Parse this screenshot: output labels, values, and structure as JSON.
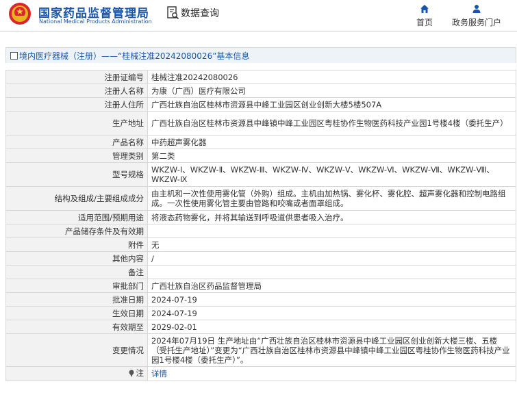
{
  "header": {
    "brand_cn": "国家药品监督管理局",
    "brand_en": "National Medical Products Administration",
    "search_label": "数据查询",
    "nav": {
      "home": "首页",
      "portal": "政务服务门户"
    },
    "accent": "#1a56a8"
  },
  "breadcrumb": "境内医疗器械（注册）——“桂械注准20242080026”基本信息",
  "rows": [
    {
      "label": "注册证编号",
      "value": "桂械注准20242080026"
    },
    {
      "label": "注册人名称",
      "value": "为康（广西）医疗有限公司"
    },
    {
      "label": "注册人住所",
      "value": "广西壮族自治区桂林市资源县中峰工业园区创业创新大楼5楼507A"
    },
    {
      "label": "生产地址",
      "value": "广西壮族自治区桂林市资源县中峰镇中峰工业园区粤桂协作生物医药科技产业园1号楼4楼（委托生产）"
    },
    {
      "label": "产品名称",
      "value": "中药超声雾化器"
    },
    {
      "label": "管理类别",
      "value": "第二类"
    },
    {
      "label": "型号规格",
      "value": "WKZW-Ⅰ、WKZW-Ⅱ、WKZW-Ⅲ、WKZW-Ⅳ、WKZW-Ⅴ、WKZW-Ⅵ、WKZW-Ⅶ、WKZW-Ⅷ、WKZW-Ⅸ"
    },
    {
      "label": "结构及组成/主要组成成分",
      "value": "由主机和一次性使用雾化管（外购）组成。主机由加热锅、雾化杯、雾化腔、超声雾化器和控制电路组成。一次性使用雾化管主要由管路和咬嘴或者面罩组成。"
    },
    {
      "label": "适用范围/预期用途",
      "value": "将液态药物雾化，并将其输送到呼吸道供患者吸入治疗。"
    },
    {
      "label": "产品储存条件及有效期",
      "value": ""
    },
    {
      "label": "附件",
      "value": "无"
    },
    {
      "label": "其他内容",
      "value": "/"
    },
    {
      "label": "备注",
      "value": ""
    },
    {
      "label": "审批部门",
      "value": "广西壮族自治区药品监督管理局"
    },
    {
      "label": "批准日期",
      "value": "2024-07-19"
    },
    {
      "label": "生效日期",
      "value": "2024-07-19"
    },
    {
      "label": "有效期至",
      "value": "2029-02-01"
    },
    {
      "label": "变更情况",
      "value": "2024年07月19日 生产地址由“广西壮族自治区桂林市资源县中峰工业园区创业创新大楼三楼、五楼（受托生产地址）”变更为“广西壮族自治区桂林市资源县中峰镇中峰工业园区粤桂协作生物医药科技产业园1号楼4楼（委托生产）”。"
    }
  ],
  "note": {
    "label": "注",
    "value": "详情",
    "icon": "pin-icon"
  }
}
